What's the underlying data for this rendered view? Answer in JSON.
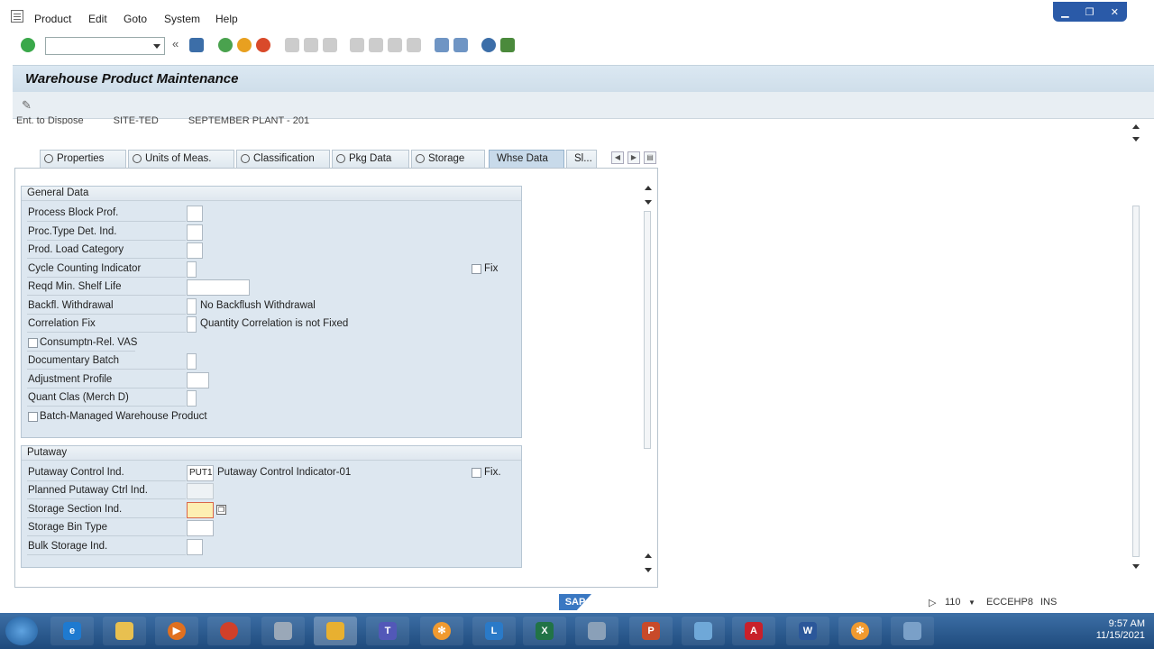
{
  "menu": {
    "items": [
      "Product",
      "Edit",
      "Goto",
      "System",
      "Help"
    ]
  },
  "toolbar": {
    "command_value": ""
  },
  "title": "Warehouse Product Maintenance",
  "cut_row": {
    "label": "Ent. to Dispose",
    "value": "SITE-TED",
    "desc": "SEPTEMBER PLANT - 201"
  },
  "tabs": [
    "Properties",
    "Units of Meas.",
    "Classification",
    "Pkg Data",
    "Storage",
    "Whse Data",
    "Sl..."
  ],
  "general_data": {
    "header": "General Data",
    "process_block_prof": "Process Block Prof.",
    "proc_type_det_ind": "Proc.Type Det. Ind.",
    "prod_load_category": "Prod. Load Category",
    "cycle_counting_indicator": "Cycle Counting Indicator",
    "fix_label": "Fix",
    "reqd_min_shelf_life": "Reqd Min. Shelf Life",
    "backfl_withdrawal": "Backfl. Withdrawal",
    "backfl_withdrawal_text": "No Backflush Withdrawal",
    "correlation_fix": "Correlation Fix",
    "correlation_fix_text": "Quantity Correlation is not Fixed",
    "consumptn_rel_vas": "Consumptn-Rel. VAS",
    "documentary_batch": "Documentary Batch",
    "adjustment_profile": "Adjustment Profile",
    "quant_clas": "Quant Clas (Merch D)",
    "batch_managed": "Batch-Managed Warehouse Product"
  },
  "putaway": {
    "header": "Putaway",
    "putaway_control_ind": "Putaway Control Ind.",
    "putaway_control_value": "PUT1",
    "putaway_control_text": "Putaway Control Indicator-01",
    "fix_label": "Fix.",
    "planned_putaway_ctrl_ind": "Planned Putaway Ctrl Ind.",
    "storage_section_ind": "Storage Section Ind.",
    "storage_bin_type": "Storage Bin Type",
    "bulk_storage_ind": "Bulk Storage Ind."
  },
  "status": {
    "logo": "SAP",
    "session": "110",
    "system": "ECCEHP8",
    "mode": "INS"
  },
  "taskbar": {
    "time": "9:57 AM",
    "date": "11/15/2021"
  },
  "colors": {
    "accent": "#2a5aa8",
    "panel": "#dde7f0",
    "focus": "#fdefb2"
  }
}
